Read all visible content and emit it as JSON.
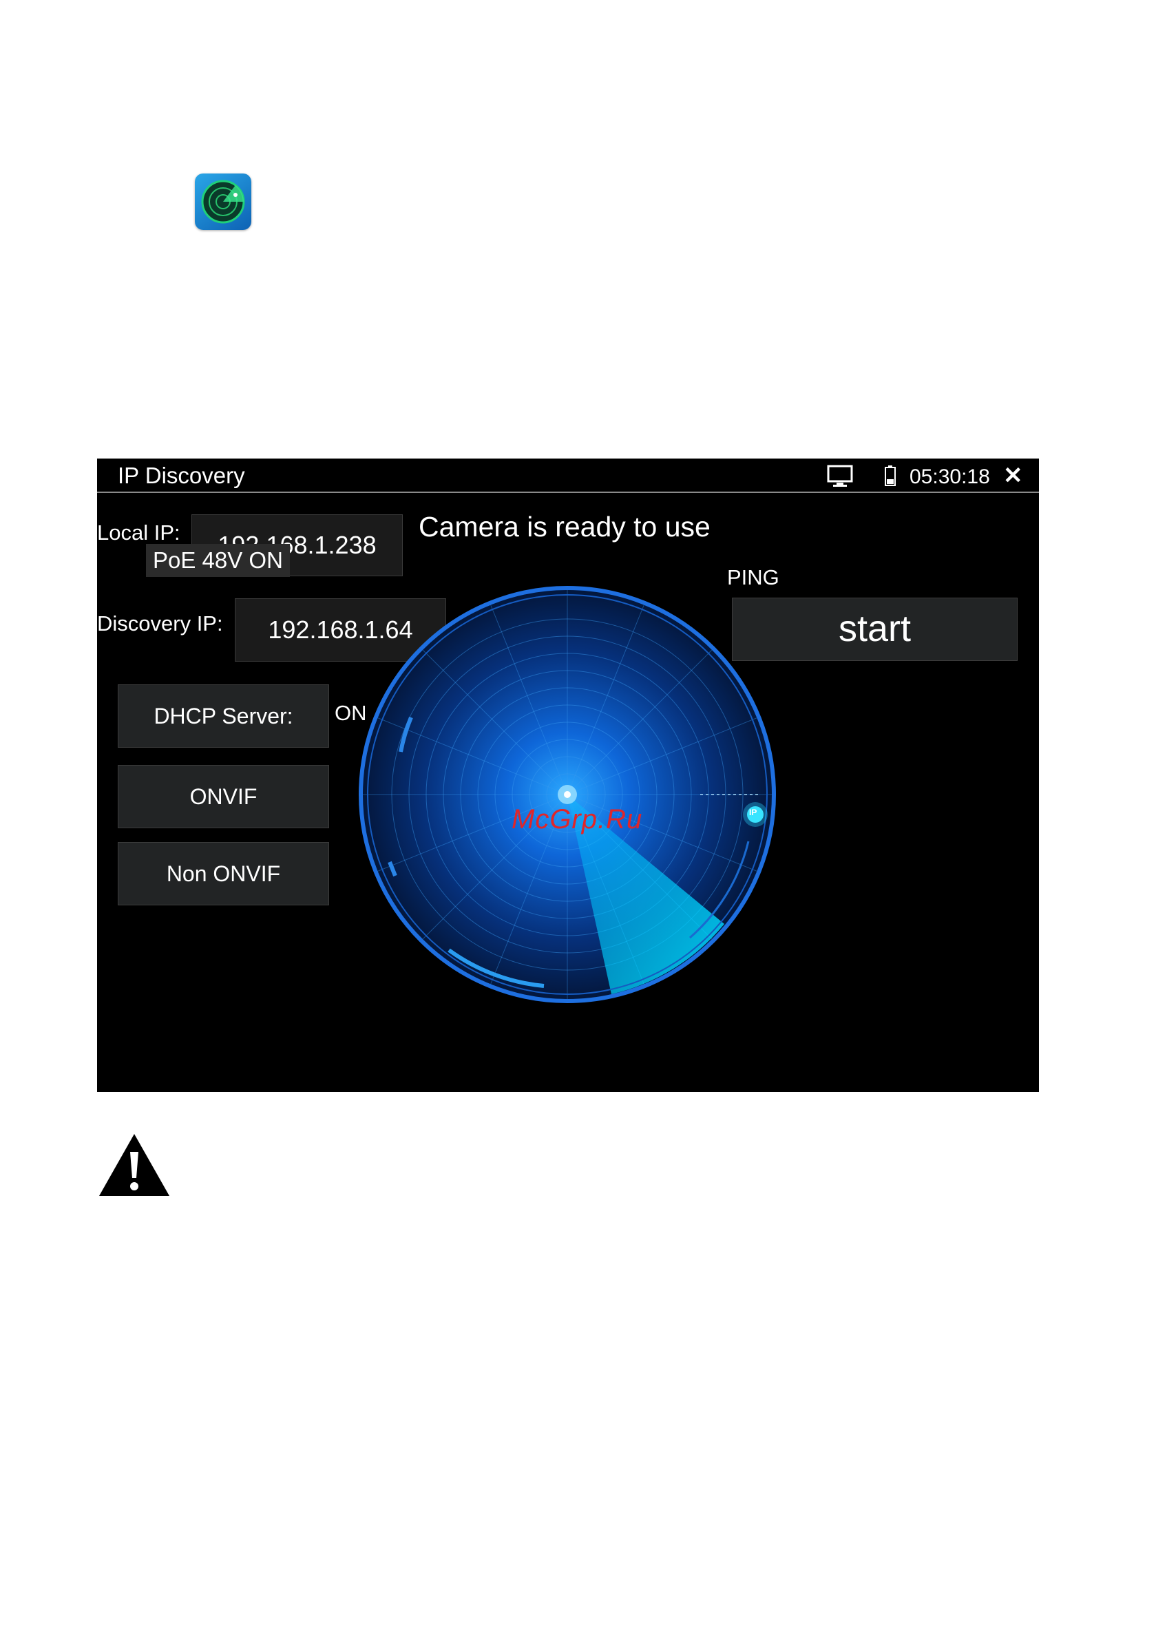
{
  "app_icon": {
    "name": "radar-app-icon"
  },
  "window": {
    "title": "IP Discovery"
  },
  "status": {
    "time": "05:30:18",
    "close_glyph": "✕"
  },
  "local_ip": {
    "label": "Local IP:",
    "value": "192.168.1.238"
  },
  "poe": {
    "text": "PoE 48V ON"
  },
  "camera_status": "Camera is ready to use",
  "discovery_ip": {
    "label": "Discovery IP:",
    "value": "192.168.1.64"
  },
  "ping": {
    "label": "PING",
    "button": "start"
  },
  "dhcp": {
    "button": "DHCP Server:",
    "state": "ON"
  },
  "buttons": {
    "onvif": "ONVIF",
    "non_onvif": "Non ONVIF"
  },
  "radar": {
    "target_label": "IP"
  },
  "watermark": "McGrp.Ru",
  "colors": {
    "accent": "#1e90ff",
    "background": "#000000",
    "button": "#222425"
  }
}
